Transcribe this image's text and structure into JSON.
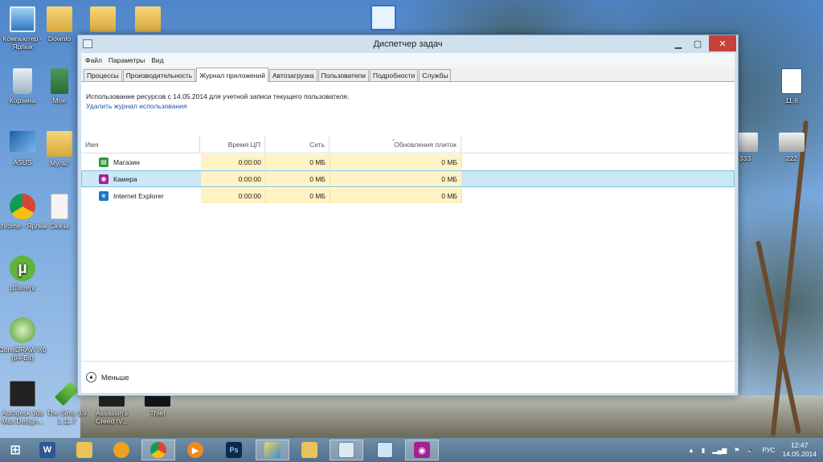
{
  "desktop": {
    "icons": [
      {
        "label": "Компьютер - Ярлык",
        "icon": "computer-icon"
      },
      {
        "label": "Downlo",
        "icon": "folder-icon"
      },
      {
        "label": "Корзина",
        "icon": "recycle-bin-icon"
      },
      {
        "label": "Мое",
        "icon": "image-icon"
      },
      {
        "label": "ASUS",
        "icon": "asus-icon"
      },
      {
        "label": "Мульт",
        "icon": "folder-icon"
      },
      {
        "label": "chrome - Ярлык",
        "icon": "chrome-icon"
      },
      {
        "label": "Скача",
        "icon": "document-icon"
      },
      {
        "label": "µTorrent",
        "icon": "utorrent-icon"
      },
      {
        "label": "CorelDRAW X6 (64-Bit)",
        "icon": "coreldraw-icon"
      },
      {
        "label": "Autodesk 3ds Max Design...",
        "icon": "3dsmax-icon"
      },
      {
        "label": "The Sims 3.v 1.11.7",
        "icon": "sims-icon"
      },
      {
        "label": "Assassin's Creed IV...",
        "icon": "game-icon"
      },
      {
        "label": "Thief",
        "icon": "game-icon"
      },
      {
        "label": "11.6",
        "icon": "word-doc-icon"
      },
      {
        "label": "333",
        "icon": "printer-icon"
      },
      {
        "label": "222",
        "icon": "printer-icon"
      }
    ]
  },
  "window": {
    "title": "Диспетчер задач",
    "menu": [
      "Файл",
      "Параметры",
      "Вид"
    ],
    "tabs": [
      "Процессы",
      "Производительность",
      "Журнал приложений",
      "Автозагрузка",
      "Пользователи",
      "Подробности",
      "Службы"
    ],
    "active_tab": "Журнал приложений",
    "info_text": "Использование ресурсов с 14.05.2014 для учетной записи текущего пользователя.",
    "delete_link": "Удалить журнал использования",
    "columns": {
      "name": "Имя",
      "cpu": "Время ЦП",
      "network": "Сеть",
      "tiles": "Обновления плиток"
    },
    "rows": [
      {
        "name": "Магазин",
        "icon": "store-icon",
        "cpu": "0:00:00",
        "network": "0 МБ",
        "tiles": "0 МБ",
        "selected": false
      },
      {
        "name": "Камера",
        "icon": "camera-icon",
        "cpu": "0:00:00",
        "network": "0 МБ",
        "tiles": "0 МБ",
        "selected": true
      },
      {
        "name": "Internet Explorer",
        "icon": "internet-explorer-icon",
        "cpu": "0:00:00",
        "network": "0 МБ",
        "tiles": "0 МБ",
        "selected": false
      }
    ],
    "fewer_label": "Меньше"
  },
  "taskbar": {
    "start_icon": "windows-start-icon",
    "apps": [
      "word-icon",
      "explorer-icon",
      "orange-app-icon",
      "chrome-icon",
      "media-player-icon",
      "photoshop-icon",
      "paint-icon",
      "folder-icon",
      "task-manager-icon",
      "network-app-icon",
      "camera-icon"
    ],
    "tray": {
      "language": "РУС",
      "time": "12:47",
      "date": "14.05.2014"
    }
  },
  "colors": {
    "selected_row": "#cbe8f6",
    "heat_cell": "#fff2c4",
    "close_button": "#c7403a",
    "link": "#1b5aa5"
  }
}
